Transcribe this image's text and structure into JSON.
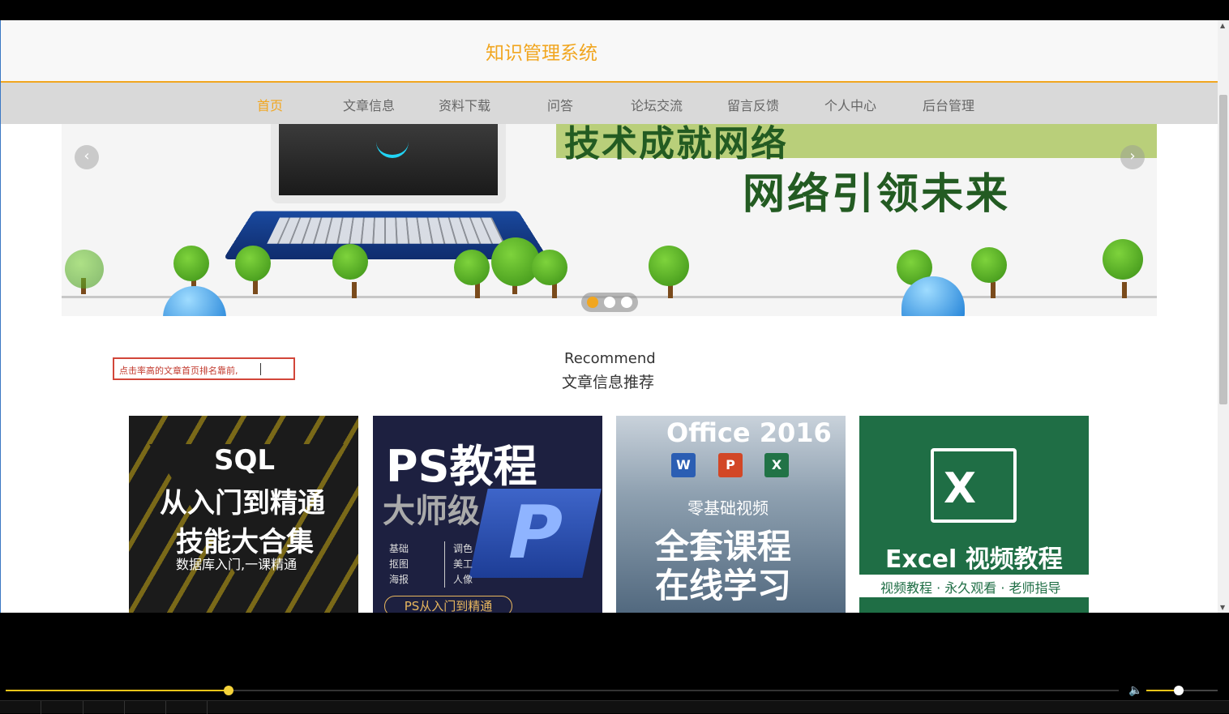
{
  "site": {
    "title": "知识管理系统",
    "accent": "#f1a620"
  },
  "nav": {
    "items": [
      {
        "label": "首页",
        "active": true
      },
      {
        "label": "文章信息",
        "active": false
      },
      {
        "label": "资料下载",
        "active": false
      },
      {
        "label": "问答",
        "active": false
      },
      {
        "label": "论坛交流",
        "active": false
      },
      {
        "label": "留言反馈",
        "active": false
      },
      {
        "label": "个人中心",
        "active": false
      },
      {
        "label": "后台管理",
        "active": false
      }
    ]
  },
  "banner": {
    "headline": "技术成就网络",
    "subline": "网络引领未来",
    "prev_icon": "chevron-left-icon",
    "next_icon": "chevron-right-icon",
    "slide_count": 3,
    "active_slide": 1
  },
  "section": {
    "title_en": "Recommend",
    "title_zh": "文章信息推荐"
  },
  "annotation": {
    "text": "点击率高的文章首页排名靠前,",
    "border_color": "#d2463a"
  },
  "cards": [
    {
      "title1": "SQL",
      "title2": "从入门到精通",
      "title3": "技能大合集",
      "sub": "数据库入门,一课精通"
    },
    {
      "title": "PS教程",
      "sub": "大师级",
      "list_left": [
        "基础",
        "抠图",
        "海报"
      ],
      "list_right": [
        "调色",
        "美工",
        "人像"
      ],
      "badge": "PS从入门到精通"
    },
    {
      "title": "Office 2016",
      "icons": [
        "W",
        "P",
        "X"
      ],
      "sub": "零基础视频",
      "line1": "全套课程",
      "line2": "在线学习"
    },
    {
      "icon": "X",
      "title": "Excel 视频教程",
      "band": "视频教程 · 永久观看 · 老师指导"
    }
  ],
  "player": {
    "progress": 0.2,
    "volume": 0.45,
    "volume_icon": "speaker-icon"
  }
}
